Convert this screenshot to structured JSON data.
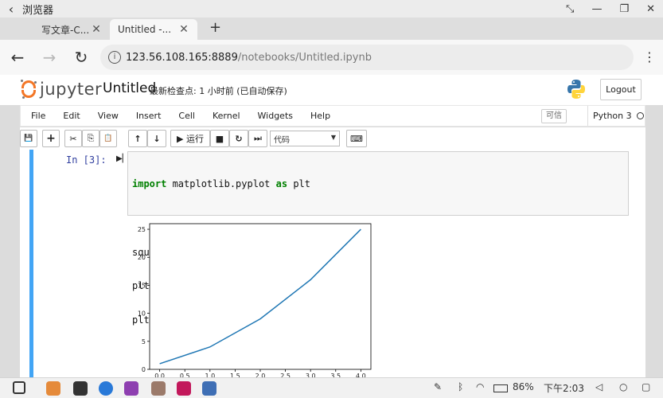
{
  "titlebar": {
    "title": "浏览器",
    "back_glyph": "‹",
    "controls": [
      "⤡",
      "—",
      "❐",
      "✕"
    ]
  },
  "tabs": [
    {
      "label": "写文章-C...",
      "active": false,
      "close": "✕"
    },
    {
      "label": "Untitled -...",
      "active": true,
      "close": "✕"
    }
  ],
  "newtab": "+",
  "nav": {
    "back": "←",
    "forward": "→",
    "reload": "↻",
    "menu": "⋮"
  },
  "address": {
    "info": "i",
    "host": "123.56.108.165:8889",
    "path": "/notebooks/Untitled.ipynb"
  },
  "jupyter": {
    "logo_text": "jupyter",
    "notebook_name": "Untitled",
    "checkpoint": "最新检查点: 1 小时前   (已自动保存)",
    "logout": "Logout"
  },
  "menubar": {
    "items": [
      "File",
      "Edit",
      "View",
      "Insert",
      "Cell",
      "Kernel",
      "Widgets",
      "Help"
    ],
    "trusted": "可信",
    "kernel": "Python 3"
  },
  "toolbar": {
    "save": "💾",
    "add": "+",
    "cut": "✂",
    "copy": "⎘",
    "paste": "📋",
    "up": "↑",
    "down": "↓",
    "run": "▶ 运行",
    "stop": "■",
    "restart": "↻",
    "fast_forward": "⏭",
    "cell_type": "代码",
    "keyboard": "⌨"
  },
  "cell": {
    "prompt": "In [3]:",
    "code_lines": [
      "import matplotlib.pyplot as plt",
      "",
      "squares = [1,4,9,16,25]",
      "plt.plot(squares)",
      "plt.show()"
    ]
  },
  "chart_data": {
    "type": "line",
    "x": [
      0,
      1,
      2,
      3,
      4
    ],
    "series": [
      {
        "values": [
          1,
          4,
          9,
          16,
          25
        ]
      }
    ],
    "xlim": [
      -0.2,
      4.2
    ],
    "ylim": [
      0,
      26
    ],
    "xticks": [
      "0.0",
      "0.5",
      "1.0",
      "1.5",
      "2.0",
      "2.5",
      "3.0",
      "3.5",
      "4.0"
    ],
    "yticks": [
      "0",
      "5",
      "10",
      "15",
      "20",
      "25"
    ],
    "line_color": "#1f77b4",
    "grid": false
  },
  "taskbar": {
    "battery": "86%",
    "time": "下午2:03"
  }
}
